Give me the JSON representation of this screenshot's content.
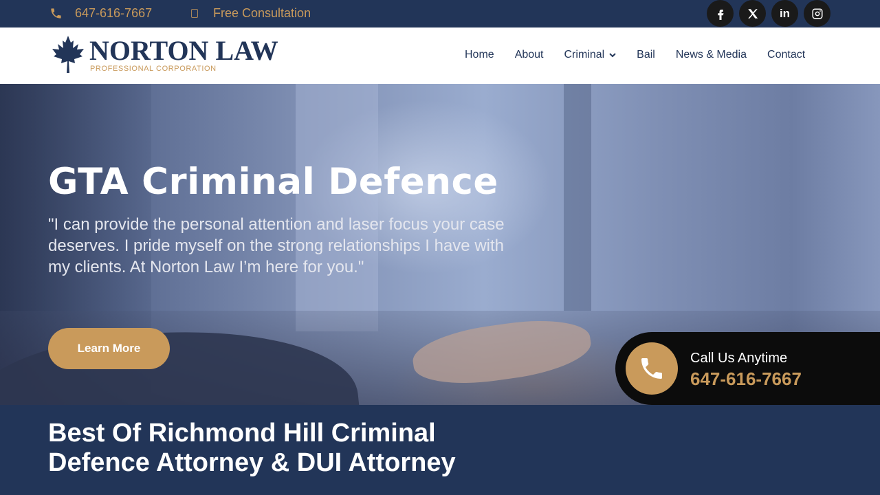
{
  "topbar": {
    "phone": "647-616-7667",
    "consultation": "Free Consultation",
    "social": [
      {
        "icon": "facebook-icon"
      },
      {
        "icon": "x-twitter-icon"
      },
      {
        "icon": "linkedin-icon",
        "label": "in"
      },
      {
        "icon": "instagram-icon"
      }
    ]
  },
  "header": {
    "logo_name": "NORTON LAW",
    "logo_sub": "PROFESSIONAL CORPORATION",
    "nav": [
      "Home",
      "About",
      "Criminal",
      "Bail",
      "News & Media",
      "Contact"
    ]
  },
  "hero": {
    "title": "GTA Criminal Defence",
    "quote": "\"I can provide the personal attention and laser focus your case deserves. I pride myself on the strong relationships I have with my clients. At Norton Law I’m here for you.\"",
    "button": "Learn More"
  },
  "callbox": {
    "label": "Call Us Anytime",
    "phone": "647-616-7667"
  },
  "section": {
    "heading": "Best Of Richmond Hill Criminal Defence Attorney & DUI Attorney"
  },
  "colors": {
    "navy": "#223558",
    "gold": "#c99a5b",
    "black": "#0c0c0c"
  }
}
